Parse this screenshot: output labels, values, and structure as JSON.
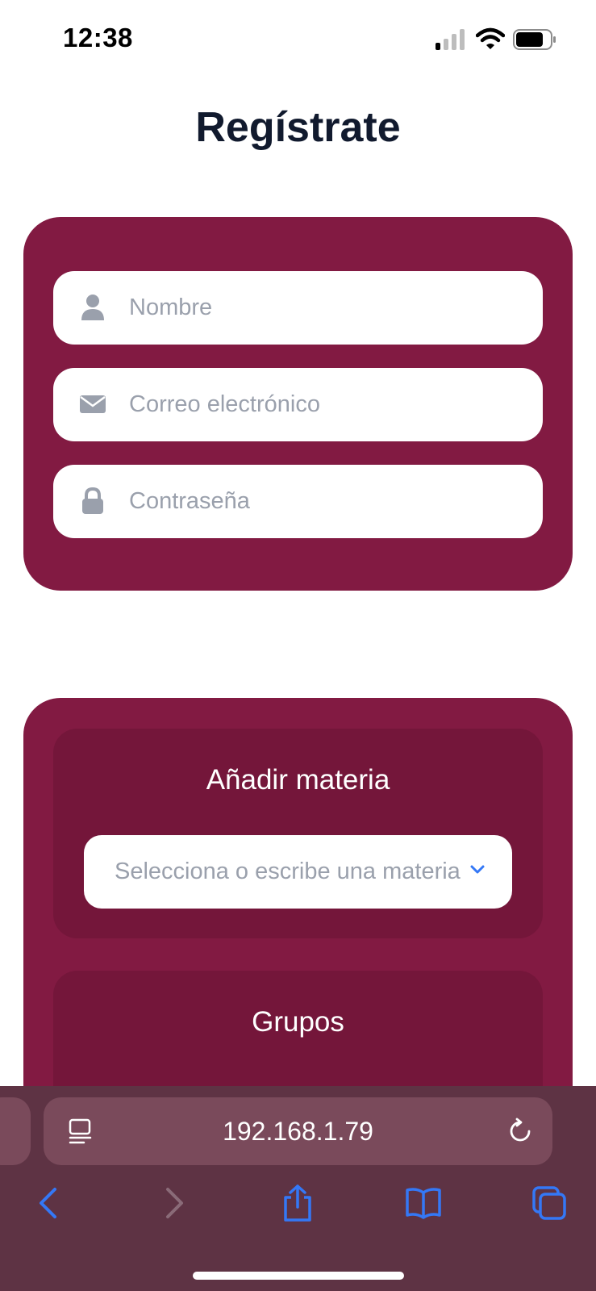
{
  "status_bar": {
    "time": "12:38",
    "icons": [
      "cellular-signal-icon",
      "wifi-icon",
      "battery-icon"
    ]
  },
  "page": {
    "title": "Regístrate"
  },
  "form": {
    "name_placeholder": "Nombre",
    "email_placeholder": "Correo electrónico",
    "password_placeholder": "Contraseña",
    "icons": [
      "user-icon",
      "envelope-icon",
      "lock-icon"
    ]
  },
  "subjects": {
    "add_title": "Añadir materia",
    "select_placeholder": "Selecciona o escribe una materia",
    "groups_title": "Grupos"
  },
  "browser": {
    "url": "192.168.1.79",
    "toolbar_icons": [
      "back-icon",
      "forward-icon",
      "share-icon",
      "bookmarks-icon",
      "tabs-icon"
    ]
  },
  "colors": {
    "card_bg": "#821a42",
    "panel_bg": "#74163a",
    "title_text": "#111a2e",
    "placeholder_text": "#9aa0ac",
    "browser_bar": "#5e3344",
    "accent_blue": "#3478f6"
  }
}
